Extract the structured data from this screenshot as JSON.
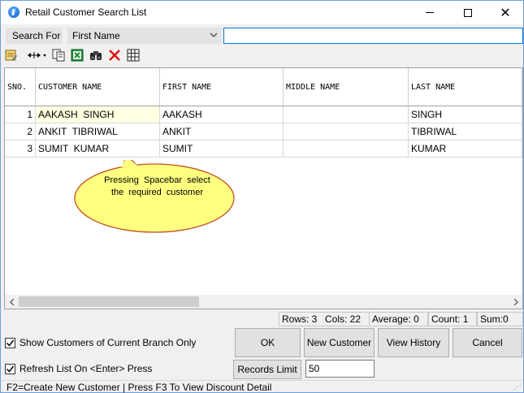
{
  "window": {
    "title": "Retail Customer Search List",
    "minimize_glyph": "minimize",
    "maximize_glyph": "maximize",
    "close_glyph": "✕"
  },
  "search": {
    "label": "Search For",
    "field_selected": "First Name",
    "query_value": ""
  },
  "toolbar": {
    "icons": [
      "edit-list-icon",
      "column-width-icon",
      "copy-icon",
      "excel-icon",
      "find-icon",
      "delete-icon",
      "grid-icon"
    ]
  },
  "grid": {
    "columns": [
      "SNO.",
      "CUSTOMER NAME",
      "FIRST NAME",
      "MIDDLE NAME",
      "LAST NAME"
    ],
    "rows": [
      {
        "sno": "1",
        "customer_name": "AAKASH  SINGH",
        "first_name": "AAKASH",
        "middle_name": "",
        "last_name": "SINGH"
      },
      {
        "sno": "2",
        "customer_name": "ANKIT  TIBRIWAL",
        "first_name": "ANKIT",
        "middle_name": "",
        "last_name": "TIBRIWAL"
      },
      {
        "sno": "3",
        "customer_name": "SUMIT  KUMAR",
        "first_name": "SUMIT",
        "middle_name": "",
        "last_name": "KUMAR"
      }
    ]
  },
  "callout": {
    "line1": "Pressing  Spacebar  select",
    "line2": "the  required  customer"
  },
  "status": {
    "rows": "Rows: 3",
    "cols": "Cols: 22",
    "average": "Average: 0",
    "count": "Count: 1",
    "sum": "Sum:0"
  },
  "options": {
    "show_branch_label": "Show Customers of Current Branch Only",
    "show_branch_checked": true,
    "refresh_label": "Refresh List On <Enter> Press",
    "refresh_checked": true
  },
  "buttons": {
    "ok": "OK",
    "new_customer": "New Customer",
    "view_history": "View History",
    "cancel": "Cancel"
  },
  "records": {
    "label": "Records Limit",
    "value": "50"
  },
  "footer": {
    "text": "F2=Create New Customer | Press F3 To View Discount Detail"
  },
  "colors": {
    "selected_cell": "#ffffe1",
    "callout_fill": "#ffff80",
    "accent_border": "#0078d7"
  }
}
